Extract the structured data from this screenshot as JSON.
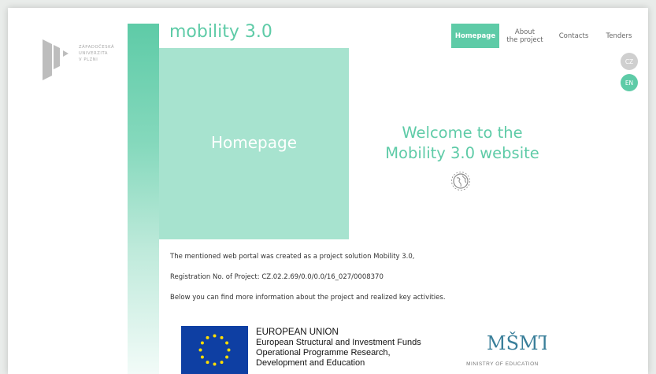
{
  "logo": {
    "lines": [
      "ZÁPADOČESKÁ",
      "UNIVERZITA",
      "V PLZNI"
    ],
    "icon": "university-logo-icon"
  },
  "site_title": "mobility 3.0",
  "nav": {
    "homepage": "Homepage",
    "about_line1": "About",
    "about_line2": "the project",
    "contacts": "Contacts",
    "tenders": "Tenders"
  },
  "lang": {
    "cz": "CZ",
    "en": "EN"
  },
  "hero": {
    "box_label": "Homepage",
    "welcome_line1": "Welcome to the",
    "welcome_line2": "Mobility 3.0 website",
    "icon": "globe-icon"
  },
  "content": {
    "line1": "The mentioned web portal was created as a project solution Mobility 3.0,",
    "line2": "Registration No. of Project:  CZ.02.2.69/0.0/0.0/16_027/0008370",
    "line3": "Below you can find more information about the project and realized key activities."
  },
  "footer": {
    "eu_line1": "EUROPEAN UNION",
    "eu_line2": "European Structural and Investment Funds",
    "eu_line3": "Operational Programme Research,",
    "eu_line4": "Development and Education",
    "msmt_caption": "MINISTRY OF EDUCATION",
    "msmt_logo": "MŠMT"
  },
  "colors": {
    "accent": "#5ecba7",
    "hero_box": "#a7e3cf",
    "eu_blue": "#0e3fa3",
    "eu_star": "#ffdd00",
    "msmt": "#3a7f9a"
  }
}
